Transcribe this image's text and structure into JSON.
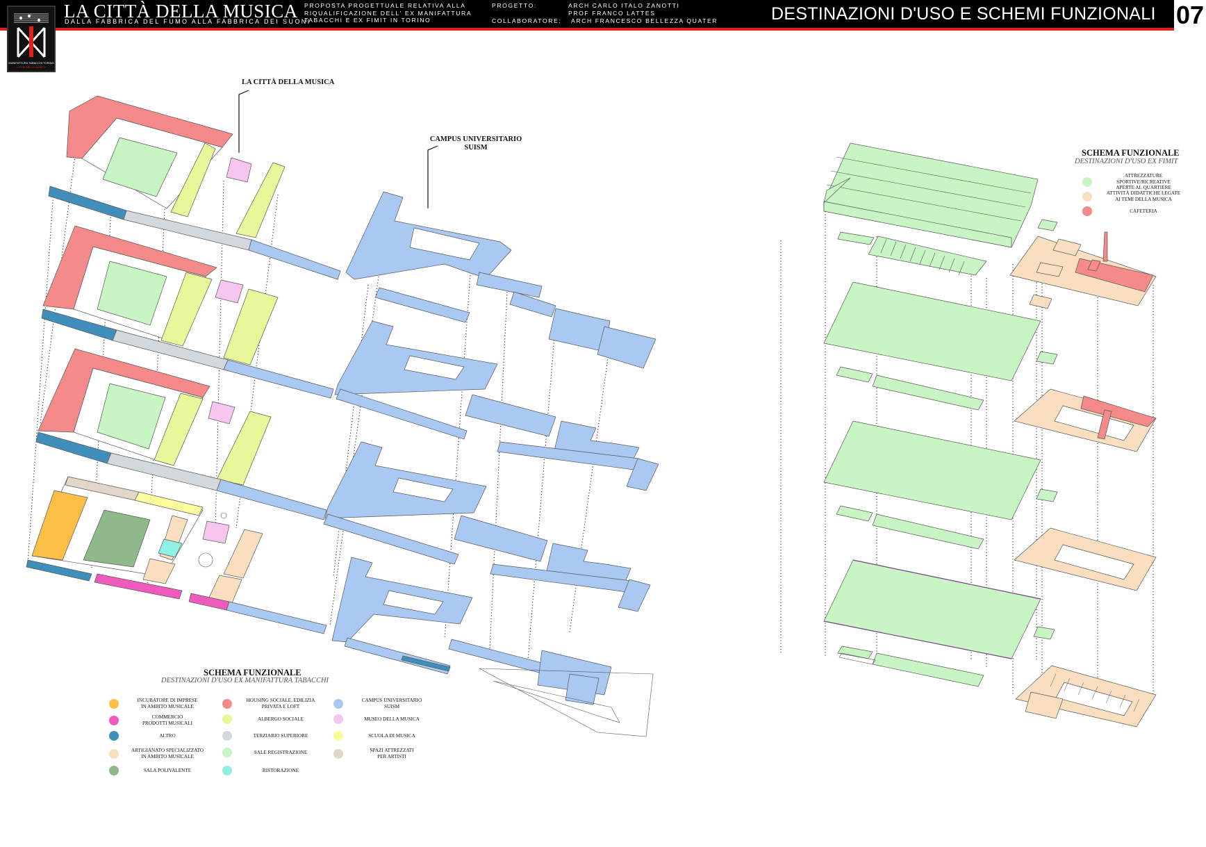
{
  "header": {
    "title": "LA CITTÀ DELLA MUSICA",
    "subtitle": "DALLA FABBRICA DEL FUMO ALLA FABBRICA DEI SUONI",
    "proposal_lines": [
      "PROPOSTA PROGETTUALE RELATIVA ALLA",
      "RIQUALIFICAZIONE DELL' EX MANIFATTURA",
      "TABACCHI E EX FIMIT IN TORINO"
    ],
    "progetto_label": "PROGETTO:",
    "progetto_value": "ARCH CARLO ITALO ZANOTTI",
    "progetto_value2": "PROF FRANCO LATTES",
    "collaboratore_label": "COLLABORATORE:",
    "collaboratore_value": "ARCH FRANCESCO BELLEZZA QUATER",
    "section_title": "DESTINAZIONI D'USO E SCHEMI FUNZIONALI",
    "page_number": "07",
    "logo_caption": "MANIFATTURA TABACCHI TORINO",
    "logo_caption2": "CITTÀ DELLA MUSICA"
  },
  "labels": {
    "citta_musica": "LA CITTÀ DELLA MUSICA",
    "campus_line1": "CAMPUS UNIVERSITARIO",
    "campus_line2": "SUISM"
  },
  "legend_left": {
    "title": "SCHEMA FUNZIONALE",
    "subtitle": "DESTINAZIONI D'USO EX MANIFATTURA TABACCHI",
    "items": [
      {
        "label": "INCUBATORE DI IMPRESE\nIN AMBITO MUSICALE",
        "color": "#fbbf47"
      },
      {
        "label": "COMMERCIO\nPRODOTTI MUSICALI",
        "color": "#ee5bbd"
      },
      {
        "label": "ALTRO",
        "color": "#3f8fba"
      },
      {
        "label": "ARTIGIANATO SPECIALIZZATO\nIN AMBITO MUSICALE",
        "color": "#f9dfc0"
      },
      {
        "label": "SALA POLIVALENTE",
        "color": "#8fb98a"
      },
      {
        "label": "HOUSING SOCIALE, EDILIZIA\nPRIVATA E LOFT",
        "color": "#f48a8a"
      },
      {
        "label": "ALBERGO SOCIALE",
        "color": "#e8f79a"
      },
      {
        "label": "TERZIARIO SUPERIORE",
        "color": "#d3d8dc"
      },
      {
        "label": "SALE REGISTRAZIONE",
        "color": "#c8f5c3"
      },
      {
        "label": "RISTORAZIONE",
        "color": "#8ff0e6"
      },
      {
        "label": "CAMPUS UNIVERSITARIO\nSUISM",
        "color": "#a9c9f2"
      },
      {
        "label": "MUSEO DELLA MUSICA",
        "color": "#f7c6ef"
      },
      {
        "label": "SCUOLA DI MUSICA",
        "color": "#fbfa9c"
      },
      {
        "label": "SPAZI ATTREZZATI\nPER ARTISTI",
        "color": "#e1d6c8"
      }
    ]
  },
  "legend_right": {
    "title": "SCHEMA FUNZIONALE",
    "subtitle": "DESTINAZIONI D'USO EX FIMIT",
    "items": [
      {
        "label": "ATTREZZATURE SPORTIVE/RICREATIVE\nAPERTE AL QUARTIERE",
        "color": "#c8f5c3"
      },
      {
        "label": "ATTIVITÀ DIDATTICHE LEGATE\nAI TEMI DELLA MUSICA",
        "color": "#f9dfc0"
      },
      {
        "label": "CAFETERIA",
        "color": "#f48a8a"
      }
    ]
  },
  "colors": {
    "housing": "#f48a8a",
    "recording": "#c8f5c3",
    "albergo": "#e8f79a",
    "museo": "#f7c6ef",
    "altro": "#3f8fba",
    "terziario": "#d3d8dc",
    "campus": "#a9c9f2",
    "incubatore": "#fbbf47",
    "sala": "#8fb98a",
    "artigianato": "#f9dfc0",
    "commercio": "#ee5bbd",
    "ristorazione": "#8ff0e6",
    "spazi": "#e1d6c8",
    "scuola": "#fbfa9c",
    "accent": "#e0211b"
  }
}
